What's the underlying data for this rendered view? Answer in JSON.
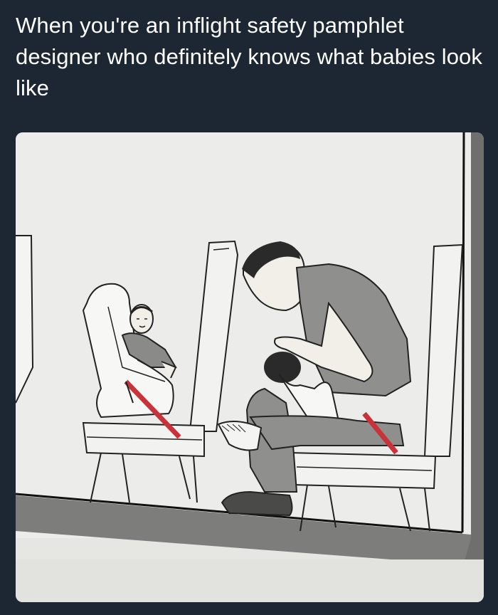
{
  "tweet": {
    "text": "When you're an inflight safety pamphlet designer who definitely knows what babies look like"
  },
  "colors": {
    "background": "#1c2733",
    "text": "#ffffff",
    "paper": "#e9eae6",
    "belt": "#c8323a"
  },
  "image": {
    "subject": "airline-safety-card-illustration"
  }
}
